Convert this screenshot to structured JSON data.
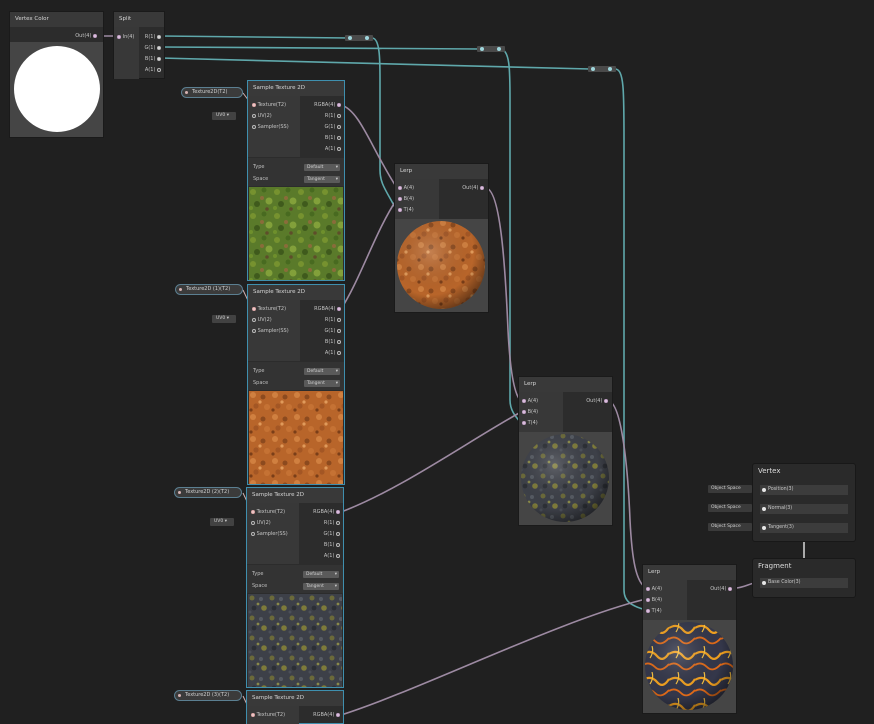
{
  "colors": {
    "background": "#202020",
    "vector_wire": "#9d8aa2",
    "float_wire": "#5fa8ab",
    "selection": "#3f8fae"
  },
  "vertex_color": {
    "title": "Vertex Color",
    "out": "Out(4)"
  },
  "split": {
    "title": "Split",
    "in": "In(4)",
    "r": "R(1)",
    "g": "G(1)",
    "b": "B(1)",
    "a": "A(1)"
  },
  "sample_ports": {
    "texture": "Texture(T2)",
    "uv": "UV(2)",
    "sampler": "Sampler(SS)",
    "rgba": "RGBA(4)",
    "r": "R(1)",
    "g": "G(1)",
    "b": "B(1)",
    "a": "A(1)",
    "type_label": "Type",
    "type_value": "Default",
    "space_label": "Space",
    "space_value": "Tangent",
    "uv_value": "UV0"
  },
  "samplers": [
    {
      "title": "Sample Texture 2D",
      "prop": "Texture2D(T2)",
      "texture": "moss"
    },
    {
      "title": "Sample Texture 2D",
      "prop": "Texture2D (1)(T2)",
      "texture": "rust"
    },
    {
      "title": "Sample Texture 2D",
      "prop": "Texture2D (2)(T2)",
      "texture": "rock"
    },
    {
      "title": "Sample Texture 2D",
      "prop": "Texture2D (3)(T2)",
      "texture": "none"
    }
  ],
  "lerp_ports": {
    "a": "A(4)",
    "b": "B(4)",
    "t": "T(4)",
    "out": "Out(4)"
  },
  "lerps": [
    {
      "title": "Lerp",
      "preview": "rust"
    },
    {
      "title": "Lerp",
      "preview": "rock"
    },
    {
      "title": "Lerp",
      "preview": "lava"
    }
  ],
  "vertex": {
    "title": "Vertex",
    "space": "Object Space",
    "blocks": [
      "Position(3)",
      "Normal(3)",
      "Tangent(3)"
    ]
  },
  "fragment": {
    "title": "Fragment",
    "blocks": [
      "Base Color(3)"
    ]
  }
}
